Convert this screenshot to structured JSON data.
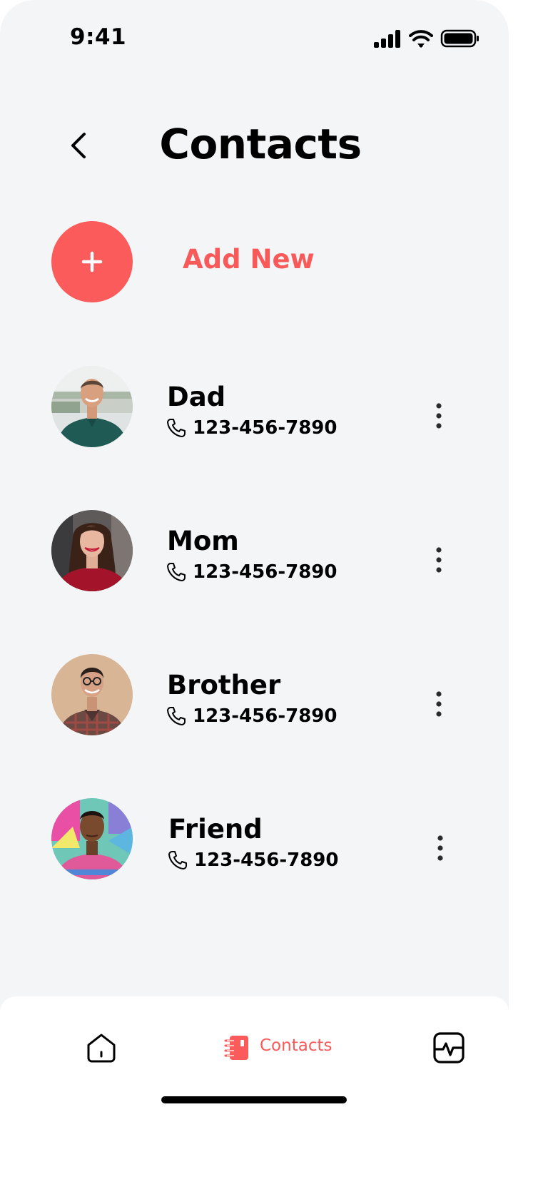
{
  "status_bar": {
    "time": "9:41"
  },
  "header": {
    "title": "Contacts"
  },
  "add_new": {
    "label": "Add New"
  },
  "contacts": [
    {
      "name": "Dad",
      "phone": "123-456-7890"
    },
    {
      "name": "Mom",
      "phone": "123-456-7890"
    },
    {
      "name": "Brother",
      "phone": "123-456-7890"
    },
    {
      "name": "Friend",
      "phone": "123-456-7890"
    }
  ],
  "bottom_nav": {
    "items": [
      {
        "icon": "home-icon",
        "label": ""
      },
      {
        "icon": "contacts-icon",
        "label": "Contacts"
      },
      {
        "icon": "activity-icon",
        "label": ""
      }
    ],
    "active_index": 1
  },
  "colors": {
    "accent": "#f85a59",
    "background": "#f4f5f7",
    "nav_background": "#ffffff",
    "text": "#000000"
  }
}
